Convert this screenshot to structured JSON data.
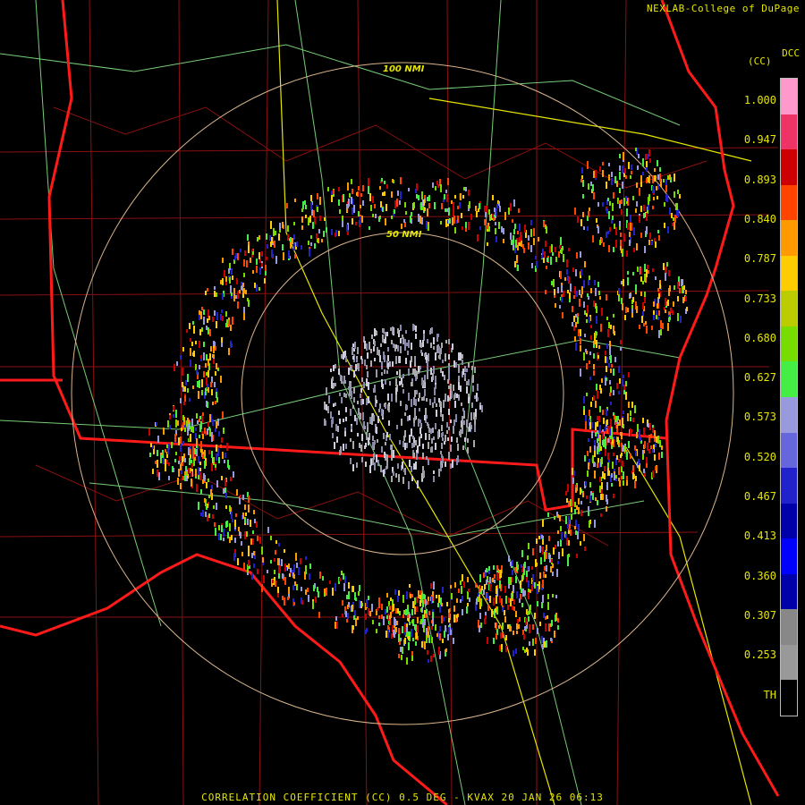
{
  "credit": "NEXLAB-College of DuPage",
  "product_code": "DCC",
  "unit": "(CC)",
  "scale": {
    "ticks": [
      "1.000",
      "0.947",
      "0.893",
      "0.840",
      "0.787",
      "0.733",
      "0.680",
      "0.627",
      "0.573",
      "0.520",
      "0.467",
      "0.413",
      "0.360",
      "0.307",
      "0.253",
      "TH"
    ],
    "colors": [
      "#ff99cc",
      "#ee3366",
      "#cc0000",
      "#ff4400",
      "#ff9900",
      "#ffcc00",
      "#bbcc00",
      "#77dd00",
      "#44ee44",
      "#9999dd",
      "#6666dd",
      "#2222cc",
      "#0000aa",
      "#0000ff",
      "#0000aa",
      "#888888",
      "#999999",
      "#000000"
    ]
  },
  "rings": [
    "50 NMI",
    "100 NMI"
  ],
  "footer": "CORRELATION COEFFICIENT (CC) 0.5 DEG - KVAX 20 JAN 26 06:13"
}
